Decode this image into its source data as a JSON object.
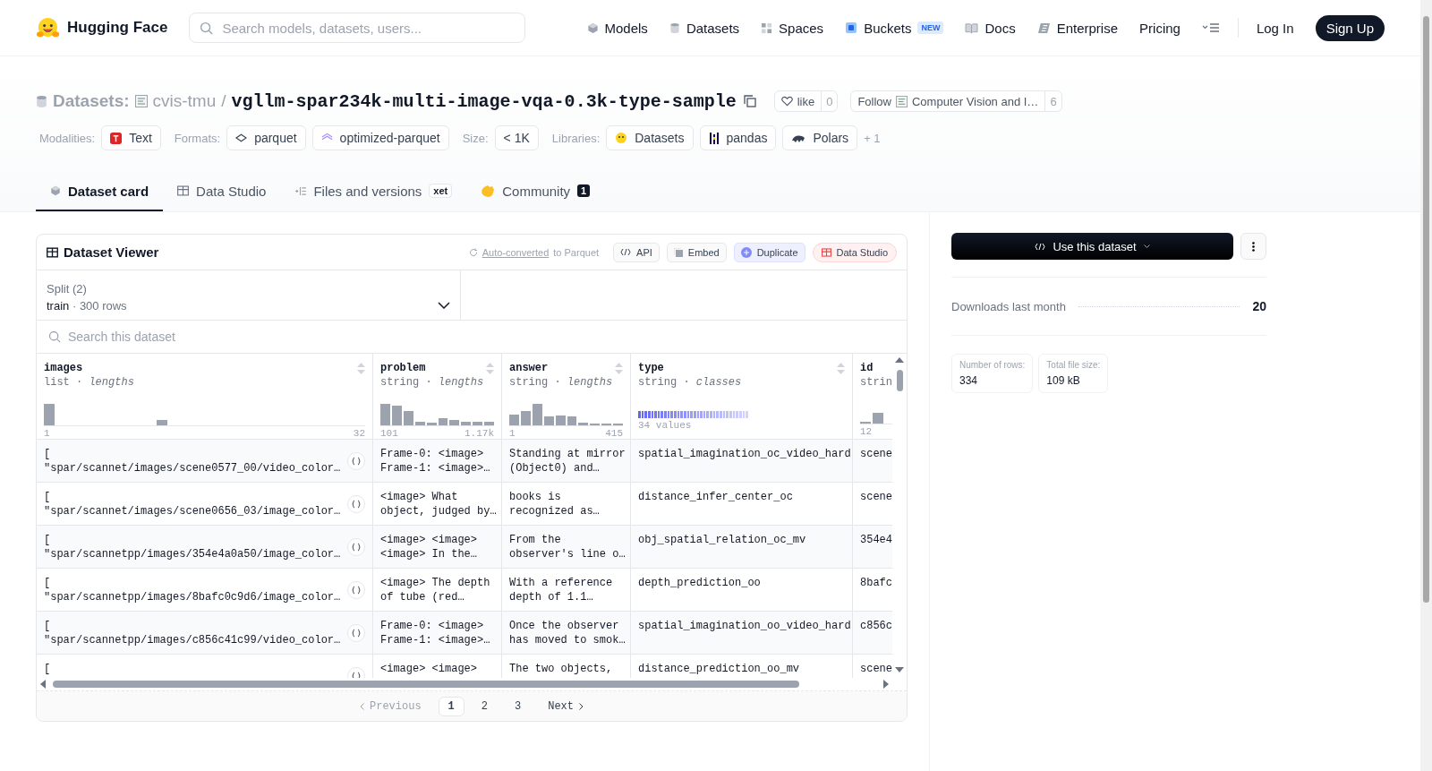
{
  "header": {
    "logo": "Hugging Face",
    "search_placeholder": "Search models, datasets, users...",
    "nav": [
      {
        "label": "Models"
      },
      {
        "label": "Datasets"
      },
      {
        "label": "Spaces"
      },
      {
        "label": "Buckets",
        "badge": "NEW"
      },
      {
        "label": "Docs"
      },
      {
        "label": "Enterprise"
      },
      {
        "label": "Pricing"
      }
    ],
    "login": "Log In",
    "signup": "Sign Up"
  },
  "repo": {
    "section": "Datasets:",
    "owner": "cvis-tmu",
    "separator": "/",
    "name": "vgllm-spar234k-multi-image-vqa-0.3k-type-sample",
    "like": "like",
    "likes": "0",
    "follow": "Follow",
    "org": "Computer Vision and I…",
    "followers": "6",
    "tag_groups": [
      {
        "label": "Modalities:",
        "items": [
          "Text"
        ]
      },
      {
        "label": "Formats:",
        "items": [
          "parquet",
          "optimized-parquet"
        ]
      },
      {
        "label": "Size:",
        "items": [
          "< 1K"
        ]
      },
      {
        "label": "Libraries:",
        "items": [
          "Datasets",
          "pandas",
          "Polars"
        ],
        "more": "+ 1"
      }
    ]
  },
  "tabs": [
    {
      "label": "Dataset card",
      "selected": true
    },
    {
      "label": "Data Studio",
      "selected": false
    },
    {
      "label": "Files and versions",
      "selected": false,
      "badge": "xet"
    },
    {
      "label": "Community",
      "selected": false,
      "count": "1"
    }
  ],
  "viewer": {
    "title": "Dataset Viewer",
    "converted_link": "Auto-converted",
    "converted_rest": "to Parquet",
    "actions": [
      "API",
      "Embed",
      "Duplicate",
      "Data Studio"
    ],
    "split_label": "Split (2)",
    "split_value": "train",
    "split_sep": "·",
    "split_rows": "300 rows",
    "search_placeholder": "Search this dataset",
    "columns": [
      {
        "name": "images",
        "type": "list · *lengths*",
        "min": "1",
        "max": "32"
      },
      {
        "name": "problem",
        "type": "string · *lengths*",
        "min": "101",
        "max": "1.17k"
      },
      {
        "name": "answer",
        "type": "string · *lengths*",
        "min": "1",
        "max": "415"
      },
      {
        "name": "type",
        "type": "string · *classes*",
        "summary": "34 values"
      },
      {
        "name": "id",
        "type": "strin",
        "min": "12"
      }
    ],
    "rows": [
      [
        "[\n\"spar/scannet/images/scene0577_00/video_color…",
        "Frame-0: <image>\nFrame-1: <image>…",
        "Standing at mirror\n(Object0) and…",
        "spatial_imagination_oc_video_hard",
        "scene"
      ],
      [
        "[\n\"spar/scannet/images/scene0656_03/image_color…",
        "<image> What\nobject, judged by…",
        "books is\nrecognized as…",
        "distance_infer_center_oc",
        "scene"
      ],
      [
        "[\n\"spar/scannetpp/images/354e4a0a50/image_color…",
        "<image> <image>\n<image> In the…",
        "From the\nobserver's line o…",
        "obj_spatial_relation_oc_mv",
        "354e4"
      ],
      [
        "[\n\"spar/scannetpp/images/8bafc0c9d6/image_color…",
        "<image> The depth\nof tube (red…",
        "With a reference\ndepth of 1.1…",
        "depth_prediction_oo",
        "8bafc"
      ],
      [
        "[\n\"spar/scannetpp/images/c856c41c99/video_color…",
        "Frame-0: <image>\nFrame-1: <image>…",
        "Once the observer\nhas moved to smok…",
        "spatial_imagination_oo_video_hard",
        "c856c"
      ],
      [
        "[",
        "<image> <image>",
        "The two objects,",
        "distance_prediction_oo_mv",
        "scene"
      ]
    ],
    "pagination": {
      "previous": "Previous",
      "pages": [
        {
          "label": "1",
          "selected": true
        },
        {
          "label": "2",
          "selected": false
        },
        {
          "label": "3",
          "selected": false
        }
      ],
      "next": "Next"
    }
  },
  "sidebar": {
    "use_button": "Use this dataset",
    "downloads_label": "Downloads last month",
    "downloads_value": "20",
    "stats": [
      {
        "label": "Number of rows:",
        "value": "334"
      },
      {
        "label": "Total file size:",
        "value": "109 kB"
      }
    ]
  }
}
